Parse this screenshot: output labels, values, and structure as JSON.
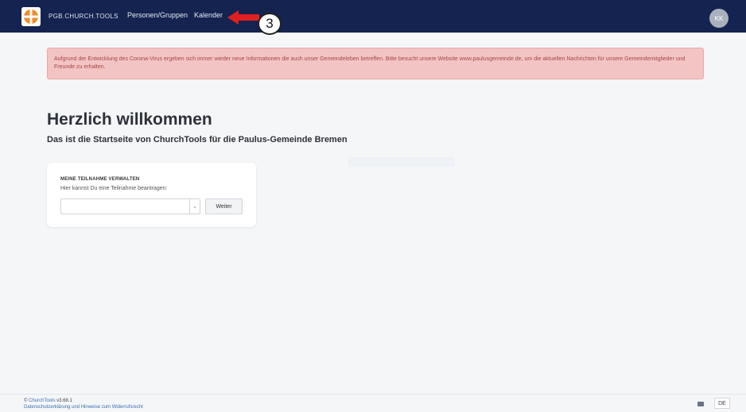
{
  "header": {
    "brand": "PGB.CHURCH.TOOLS",
    "nav": [
      "Personen/Gruppen",
      "Kalender"
    ],
    "avatar_initials": "KK"
  },
  "annotation": {
    "step_number": "3",
    "color": "#e02020"
  },
  "alert": {
    "text": "Aufgrund der Entwicklung des Corona-Virus ergeben sich immer wieder neue Informationen die auch unser Gemeindeleben betreffen. Bitte besucht unsere Website www.paulusgemeinde.de, um die aktuellen Nachrichten für unsere Gemeindemitglieder und Freunde zu erhalten."
  },
  "welcome": {
    "title": "Herzlich willkommen",
    "subtitle": "Das ist die Startseite von ChurchTools für die Paulus-Gemeinde Bremen"
  },
  "participation_card": {
    "title": "MEINE TEILNAHME VERWALTEN",
    "description": "Hier kannst Du eine Teilnahme beantragen:",
    "select_value": "",
    "button_label": "Weiter"
  },
  "footer": {
    "copyright_symbol": "©",
    "app_name": "ChurchTools",
    "version": "v3.68.1",
    "privacy_link": "Datenschutzerklärung und Hinweise zum Widerrufsrecht",
    "language": "DE"
  },
  "colors": {
    "topbar": "#14234f",
    "alert_bg": "#f3c4c4",
    "alert_text": "#a64646",
    "logo_orange": "#f08a24"
  }
}
